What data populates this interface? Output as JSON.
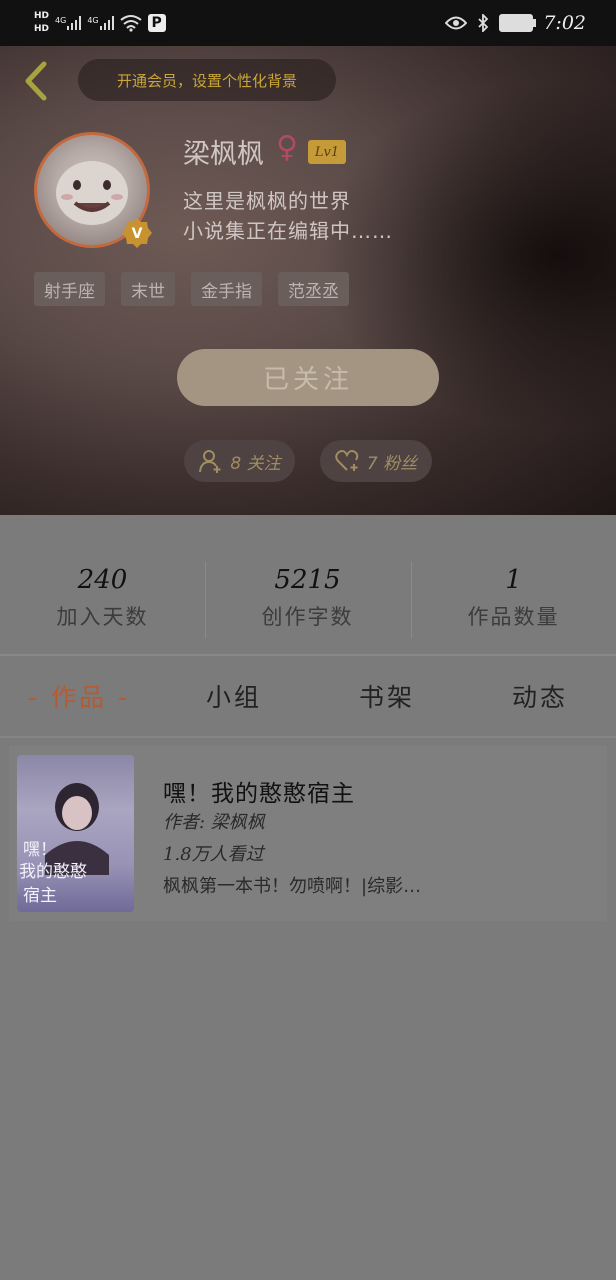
{
  "status_bar": {
    "network": [
      "HD",
      "HD"
    ],
    "sim1": "4G",
    "sim2": "4G",
    "parking_icon": "P",
    "time": "7:02"
  },
  "header": {
    "vip_prompt": "开通会员，设置个性化背景",
    "username": "梁枫枫",
    "gender_icon": "♀",
    "level": "Lv1",
    "bio_line1": "这里是枫枫的世界",
    "bio_line2": "小说集正在编辑中……",
    "tags": [
      "射手座",
      "末世",
      "金手指",
      "范丞丞"
    ],
    "follow_button": "已关注",
    "following_count": "8 关注",
    "followers_count": "7 粉丝",
    "badge_letter": "V"
  },
  "stats": [
    {
      "value": "240",
      "label": "加入天数"
    },
    {
      "value": "5215",
      "label": "创作字数"
    },
    {
      "value": "1",
      "label": "作品数量"
    }
  ],
  "tabs": [
    "- 作品 -",
    "小组",
    "书架",
    "动态"
  ],
  "book": {
    "title": "嘿！我的憨憨宿主",
    "author": "作者: 梁枫枫",
    "views": "1.8万人看过",
    "intro": "枫枫第一本书！勿喷啊！|综影…",
    "cover_text_1": "嘿！",
    "cover_text_2": "我的憨憨",
    "cover_text_3": "宿主"
  },
  "colors": {
    "accent": "#b85a2f",
    "gold": "#c9a637",
    "overlay": "#7b7b7b"
  }
}
